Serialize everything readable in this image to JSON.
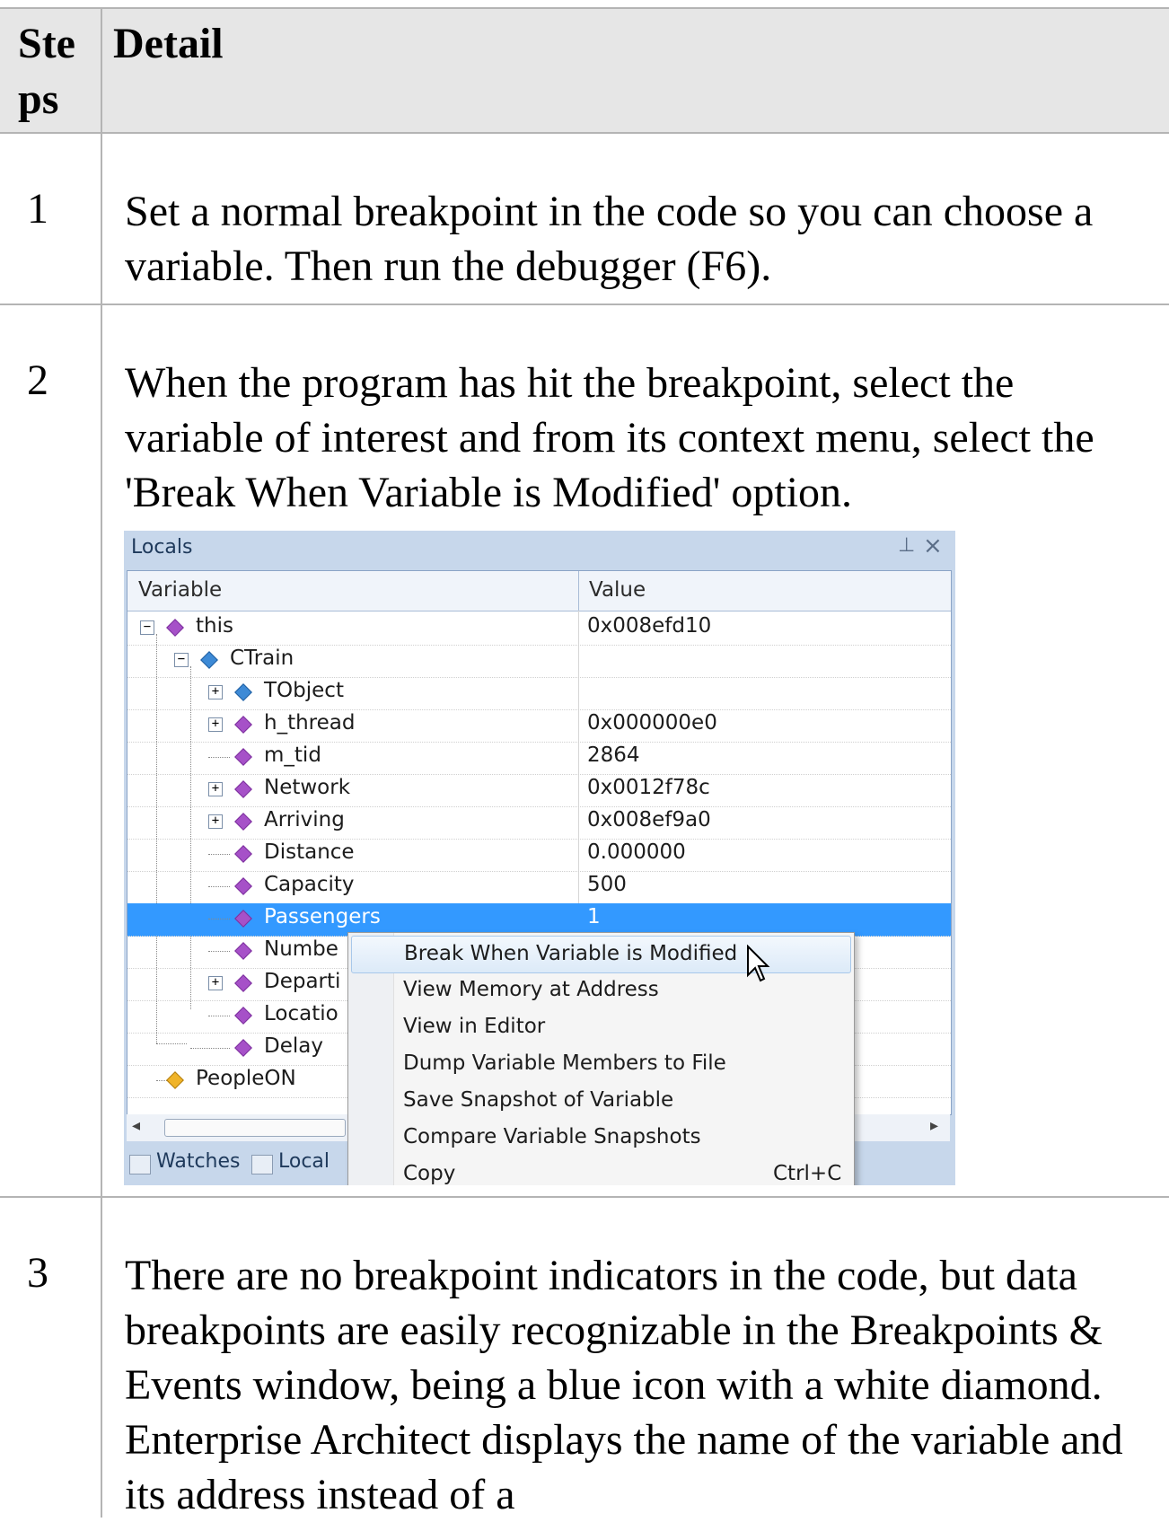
{
  "table": {
    "header_steps": "Ste ps",
    "header_detail": "Detail",
    "rows": [
      {
        "step": "1",
        "text": "Set a normal breakpoint in the code so you can choose a variable. Then run the debugger (F6)."
      },
      {
        "step": "2",
        "text": "When the program has hit the breakpoint, select the variable of interest and from its context menu, select the 'Break When Variable is Modified' option."
      },
      {
        "step": "3",
        "text": "There are no breakpoint indicators in the code, but data breakpoints are easily recognizable in the Breakpoints & Events window, being a blue icon with a white diamond. Enterprise Architect displays the name of the variable and its address instead of a"
      }
    ]
  },
  "locals_window": {
    "title": "Locals",
    "pin_icon": "pin-icon",
    "close_icon": "close-icon",
    "col_variable": "Variable",
    "col_value": "Value",
    "variables": [
      {
        "name": "this",
        "value": "0x008efd10",
        "icon": "purple-gem-icon"
      },
      {
        "name": "CTrain",
        "value": "",
        "icon": "blue-gem-icon"
      },
      {
        "name": "TObject",
        "value": "",
        "icon": "blue-gem-icon"
      },
      {
        "name": "h_thread",
        "value": "0x000000e0",
        "icon": "purple-gem-icon"
      },
      {
        "name": "m_tid",
        "value": "2864",
        "icon": "purple-gem-icon"
      },
      {
        "name": "Network",
        "value": "0x0012f78c",
        "icon": "purple-gem-icon"
      },
      {
        "name": "Arriving",
        "value": "0x008ef9a0",
        "icon": "purple-gem-icon"
      },
      {
        "name": "Distance",
        "value": "0.000000",
        "icon": "purple-gem-icon"
      },
      {
        "name": "Capacity",
        "value": "500",
        "icon": "purple-gem-icon"
      },
      {
        "name": "Passengers",
        "value": "1",
        "icon": "purple-gem-icon"
      },
      {
        "name": "Numbe",
        "value": "",
        "icon": "purple-gem-icon"
      },
      {
        "name": "Departi",
        "value": "",
        "icon": "purple-gem-icon"
      },
      {
        "name": "Locatio",
        "value": "",
        "icon": "purple-gem-icon"
      },
      {
        "name": "Delay",
        "value": "",
        "icon": "purple-gem-icon"
      },
      {
        "name": "PeopleON",
        "value": "",
        "icon": "gold-gem-icon"
      }
    ],
    "tabs": [
      {
        "label": "Watches",
        "icon": "watches-icon"
      },
      {
        "label": "Local",
        "icon": "locals-icon"
      }
    ],
    "context_menu": [
      {
        "label": "Break When Variable is Modified",
        "shortcut": ""
      },
      {
        "label": "View Memory at Address",
        "shortcut": ""
      },
      {
        "label": "View in Editor",
        "shortcut": ""
      },
      {
        "label": "Dump Variable Members to File",
        "shortcut": ""
      },
      {
        "label": "Save Snapshot of Variable",
        "shortcut": ""
      },
      {
        "label": "Compare Variable Snapshots",
        "shortcut": ""
      },
      {
        "label": "Copy",
        "shortcut": "Ctrl+C"
      }
    ]
  }
}
